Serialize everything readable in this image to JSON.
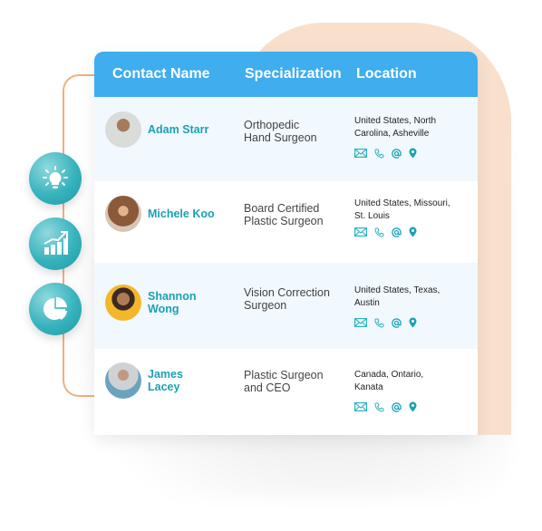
{
  "colors": {
    "header_bg": "#3fadee",
    "accent_teal": "#1aa2b2",
    "peach": "#f8e0cd",
    "connector": "#f0b07f",
    "row_alt": "#f1f8fe"
  },
  "side_icons": [
    {
      "name": "lightbulb-icon"
    },
    {
      "name": "growth-chart-icon"
    },
    {
      "name": "pie-chart-icon"
    }
  ],
  "table": {
    "headers": [
      "Contact Name",
      "Specialization",
      "Location"
    ],
    "rows": [
      {
        "name": "Adam Starr",
        "specialization": "Orthopedic\nHand Surgeon",
        "location": "United States, North\nCarolina, Asheville",
        "avatar_color": "#cfd3cf",
        "actions": [
          "email-icon",
          "phone-icon",
          "at-icon",
          "map-pin-icon"
        ]
      },
      {
        "name": "Michele Koo",
        "specialization": "Board Certified\nPlastic Surgeon",
        "location": "United States, Missouri,\nSt. Louis",
        "avatar_color": "#b88a66",
        "actions": [
          "email-icon",
          "phone-icon",
          "at-icon",
          "map-pin-icon"
        ]
      },
      {
        "name": "Shannon\nWong",
        "specialization": "Vision Correction\nSurgeon",
        "location": "United States, Texas,\nAustin",
        "avatar_color": "#f5b72a",
        "actions": [
          "email-icon",
          "phone-icon",
          "at-icon",
          "map-pin-icon"
        ]
      },
      {
        "name": "James\nLacey",
        "specialization": "Plastic Surgeon\nand CEO",
        "location": "Canada, Ontario,\nKanata",
        "avatar_color": "#c9ced2",
        "actions": [
          "email-icon",
          "phone-icon",
          "at-icon",
          "map-pin-icon"
        ]
      }
    ]
  }
}
